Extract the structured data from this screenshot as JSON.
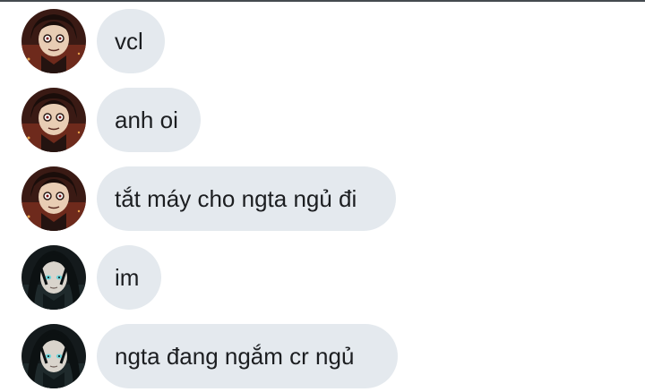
{
  "messages": [
    {
      "avatar": "sender-a-avatar",
      "text": "vcl"
    },
    {
      "avatar": "sender-a-avatar",
      "text": "anh oi"
    },
    {
      "avatar": "sender-a-avatar",
      "text": "tắt máy cho ngta ngủ đi"
    },
    {
      "avatar": "sender-b-avatar",
      "text": "im"
    },
    {
      "avatar": "sender-b-avatar",
      "text": "ngta đang ngắm cr ngủ"
    }
  ],
  "colors": {
    "bubble": "#e4e9ee",
    "text": "#1c1e21",
    "top_border": "#444a4f"
  }
}
